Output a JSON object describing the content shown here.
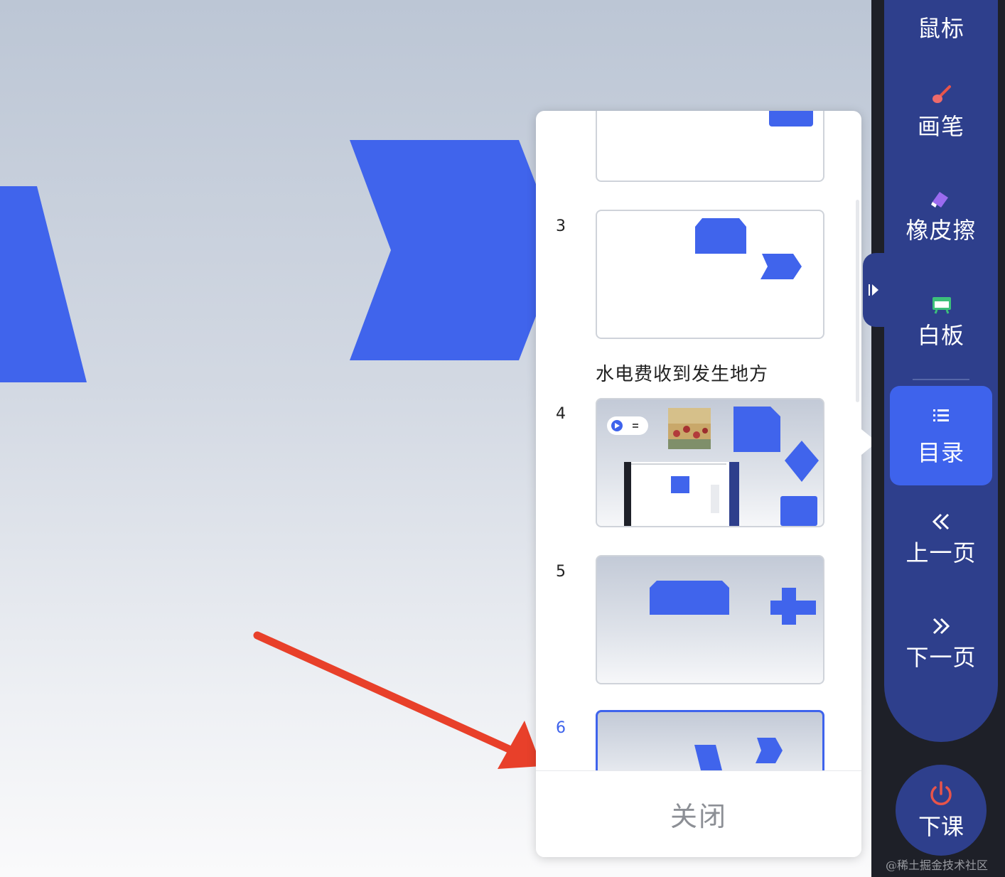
{
  "colors": {
    "accent": "#3e63ec",
    "toolbar_bg": "#2e3f8c",
    "shape_blue": "#4064ec",
    "arrow_red": "#e8402a",
    "power_red": "#e8544a"
  },
  "catalog": {
    "items": [
      {
        "page": "",
        "title": ""
      },
      {
        "page": "3",
        "title": ""
      },
      {
        "page": "4",
        "title": "水电费收到发生地方"
      },
      {
        "page": "5",
        "title": ""
      },
      {
        "page": "6",
        "title": "",
        "active": true
      }
    ],
    "close_label": "关闭"
  },
  "toolbar": {
    "mouse": {
      "label": "鼠标"
    },
    "pen": {
      "label": "画笔",
      "icon": "brush-icon"
    },
    "eraser": {
      "label": "橡皮擦",
      "icon": "eraser-icon"
    },
    "whiteboard": {
      "label": "白板",
      "icon": "whiteboard-icon"
    },
    "catalog": {
      "label": "目录",
      "icon": "list-icon",
      "active": true
    },
    "prev": {
      "label": "上一页",
      "icon": "double-chevron-left-icon"
    },
    "next": {
      "label": "下一页",
      "icon": "double-chevron-right-icon"
    }
  },
  "class_over": {
    "label": "下课",
    "icon": "power-icon"
  },
  "watermark": "@稀土掘金技术社区"
}
